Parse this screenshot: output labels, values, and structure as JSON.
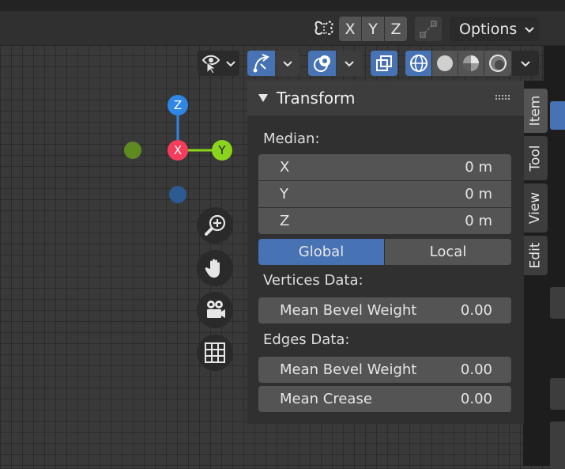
{
  "header": {
    "axes": [
      "X",
      "Y",
      "Z"
    ],
    "options_label": "Options"
  },
  "gizmo": {
    "x": "X",
    "y": "Y",
    "z": "Z"
  },
  "panel": {
    "title": "Transform",
    "median_label": "Median:",
    "fields": [
      {
        "label": "X",
        "value": "0 m"
      },
      {
        "label": "Y",
        "value": "0 m"
      },
      {
        "label": "Z",
        "value": "0 m"
      }
    ],
    "space": {
      "global": "Global",
      "local": "Local",
      "active": "Global"
    },
    "vertices_label": "Vertices Data:",
    "vertices_fields": [
      {
        "label": "Mean Bevel Weight",
        "value": "0.00"
      }
    ],
    "edges_label": "Edges Data:",
    "edges_fields": [
      {
        "label": "Mean Bevel Weight",
        "value": "0.00"
      },
      {
        "label": "Mean Crease",
        "value": "0.00"
      }
    ]
  },
  "tabs": [
    "Item",
    "Tool",
    "View",
    "Edit"
  ],
  "colors": {
    "x_axis": "#f53d5b",
    "y_axis": "#8ad41c",
    "z_axis": "#2e87e6",
    "accent": "#4772b3"
  }
}
